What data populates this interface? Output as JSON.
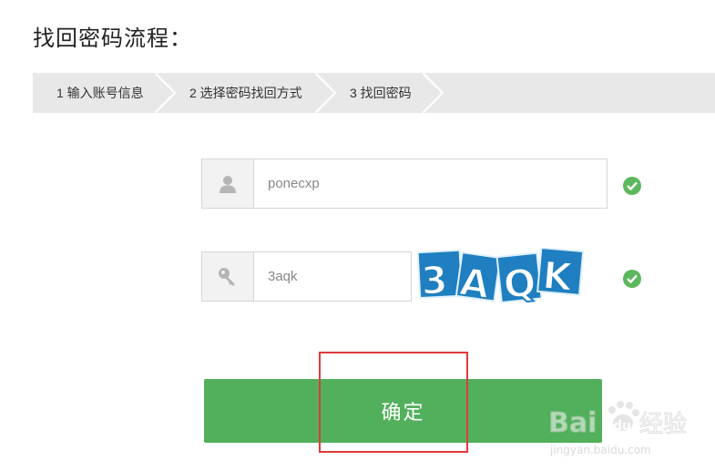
{
  "page_title": "找回密码流程：",
  "steps": [
    {
      "label": "1 输入账号信息"
    },
    {
      "label": "2 选择密码找回方式"
    },
    {
      "label": "3 找回密码"
    }
  ],
  "form": {
    "username_value": "ponecxp",
    "captcha_value": "3aqk",
    "captcha_image_text": "3AQK",
    "submit_label": "确定"
  },
  "watermark": {
    "logo_text": "Bai",
    "logo_text2": "du",
    "site_label": "经验",
    "url": "jingyan.baidu.com"
  },
  "colors": {
    "accent_green": "#52b05c",
    "check_green": "#5cb85c",
    "captcha_blue": "#1f7fc1",
    "annotation_red": "#e03a3a"
  },
  "icons": {
    "username": "user-icon",
    "captcha": "key-icon",
    "valid": "check-icon"
  }
}
